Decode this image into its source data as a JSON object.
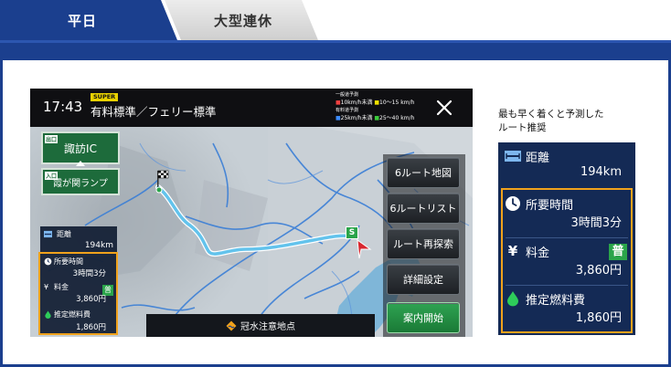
{
  "tabs": [
    {
      "label": "平日",
      "active": true
    },
    {
      "label": "大型連休",
      "active": false
    }
  ],
  "nav": {
    "clock": "17:43",
    "badge": "SUPER",
    "route_type": "有料標準／フェリー標準",
    "legend": {
      "general_caption": "一般道予測",
      "general_slow": "10km/h未満",
      "general_mid": "10〜15 km/h",
      "toll_caption": "有料道予測",
      "toll_slow": "25km/h未満",
      "toll_mid": "25〜40 km/h"
    },
    "exits": [
      {
        "tag": "出口",
        "label": "諏訪IC"
      },
      {
        "tag": "入口",
        "label": "霞が関ランプ"
      }
    ],
    "mini_summary": {
      "distance_label": "距離",
      "distance_value": "194km",
      "time_label": "所要時間",
      "time_value": "3時間3分",
      "fee_label": "料金",
      "fee_value": "3,860円",
      "fee_badge": "普",
      "fuel_label": "推定燃料費",
      "fuel_value": "1,860円"
    },
    "menu": {
      "route_map": "6ルート地図",
      "route_list": "6ルートリスト",
      "research": "ルート再探索",
      "settings": "詳細設定",
      "start": "案内開始"
    },
    "flood_notice": "冠水注意地点",
    "start_flag": "S"
  },
  "summary": {
    "caption_line1": "最も早く着くと予測した",
    "caption_line2": "ルート推奨",
    "distance_label": "距離",
    "distance_value": "194km",
    "time_label": "所要時間",
    "time_value": "3時間3分",
    "fee_label": "料金",
    "fee_value": "3,860円",
    "fee_badge": "普",
    "fuel_label": "推定燃料費",
    "fuel_value": "1,860円"
  },
  "colors": {
    "brand_blue": "#1b3f8e",
    "highlight_orange": "#f0a21c",
    "start_green": "#2aa44a",
    "route_blue": "#63c3ec"
  }
}
